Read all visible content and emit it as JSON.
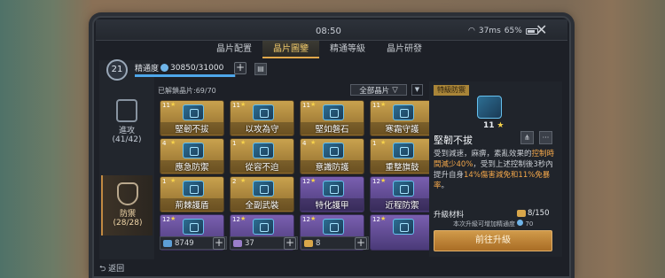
{
  "status": {
    "time": "08:50",
    "network": "37ms",
    "battery": "65%"
  },
  "tabs": [
    {
      "label": "晶片配置",
      "active": false
    },
    {
      "label": "晶片圖鑒",
      "active": true
    },
    {
      "label": "精通等級",
      "active": false
    },
    {
      "label": "晶片研發",
      "active": false
    }
  ],
  "profile": {
    "level": "21",
    "label": "精通度",
    "value": "30850/31000",
    "progress": 0.995
  },
  "categories": [
    {
      "label": "進攻",
      "count": "(41/42)",
      "active": false
    },
    {
      "label": "防禦",
      "count": "(28/28)",
      "active": true
    }
  ],
  "collection": {
    "unlocked": "已解鎖晶片:69/70",
    "filter": "全部晶片"
  },
  "cards": [
    {
      "level": "11",
      "name": "堅韌不拔",
      "rarity": "gold"
    },
    {
      "level": "11",
      "name": "以攻為守",
      "rarity": "gold"
    },
    {
      "level": "11",
      "name": "堅如磐石",
      "rarity": "gold"
    },
    {
      "level": "11",
      "name": "寒霜守護",
      "rarity": "gold"
    },
    {
      "level": "4",
      "name": "應急防禦",
      "rarity": "gold"
    },
    {
      "level": "1",
      "name": "從容不迫",
      "rarity": "gold"
    },
    {
      "level": "4",
      "name": "意識防護",
      "rarity": "gold"
    },
    {
      "level": "1",
      "name": "重整旗鼓",
      "rarity": "gold"
    },
    {
      "level": "1",
      "name": "荊棘護盾",
      "rarity": "gold"
    },
    {
      "level": "2",
      "name": "全副武裝",
      "rarity": "gold"
    },
    {
      "level": "12",
      "name": "特化護甲",
      "rarity": "purple"
    },
    {
      "level": "12",
      "name": "近程防禦",
      "rarity": "purple"
    },
    {
      "level": "12",
      "name": "",
      "rarity": "purple"
    },
    {
      "level": "12",
      "name": "",
      "rarity": "purple"
    },
    {
      "level": "12",
      "name": "",
      "rarity": "purple"
    },
    {
      "level": "12",
      "name": "",
      "rarity": "purple"
    }
  ],
  "resources": [
    {
      "value": "8749",
      "color": "#5d9fd6"
    },
    {
      "value": "37",
      "color": "#9a7ec9"
    },
    {
      "value": "8",
      "color": "#d8a64a"
    }
  ],
  "back_label": "返回",
  "detail": {
    "tag": "特級防禦",
    "level": "11",
    "title": "堅韌不拔",
    "desc_1": "受到減速，麻痹，素亂效果的",
    "desc_hl1": "控制時間減少40%",
    "desc_2": "，受到上述控制後3秒內提升自身",
    "desc_hl2": "14%傷害減免和11%免暴率",
    "desc_3": "。",
    "material_label": "升級材料",
    "material_value": "8/150",
    "note": "本次升級可增加精通度",
    "note_value": "70",
    "upgrade_label": "前往升級"
  }
}
